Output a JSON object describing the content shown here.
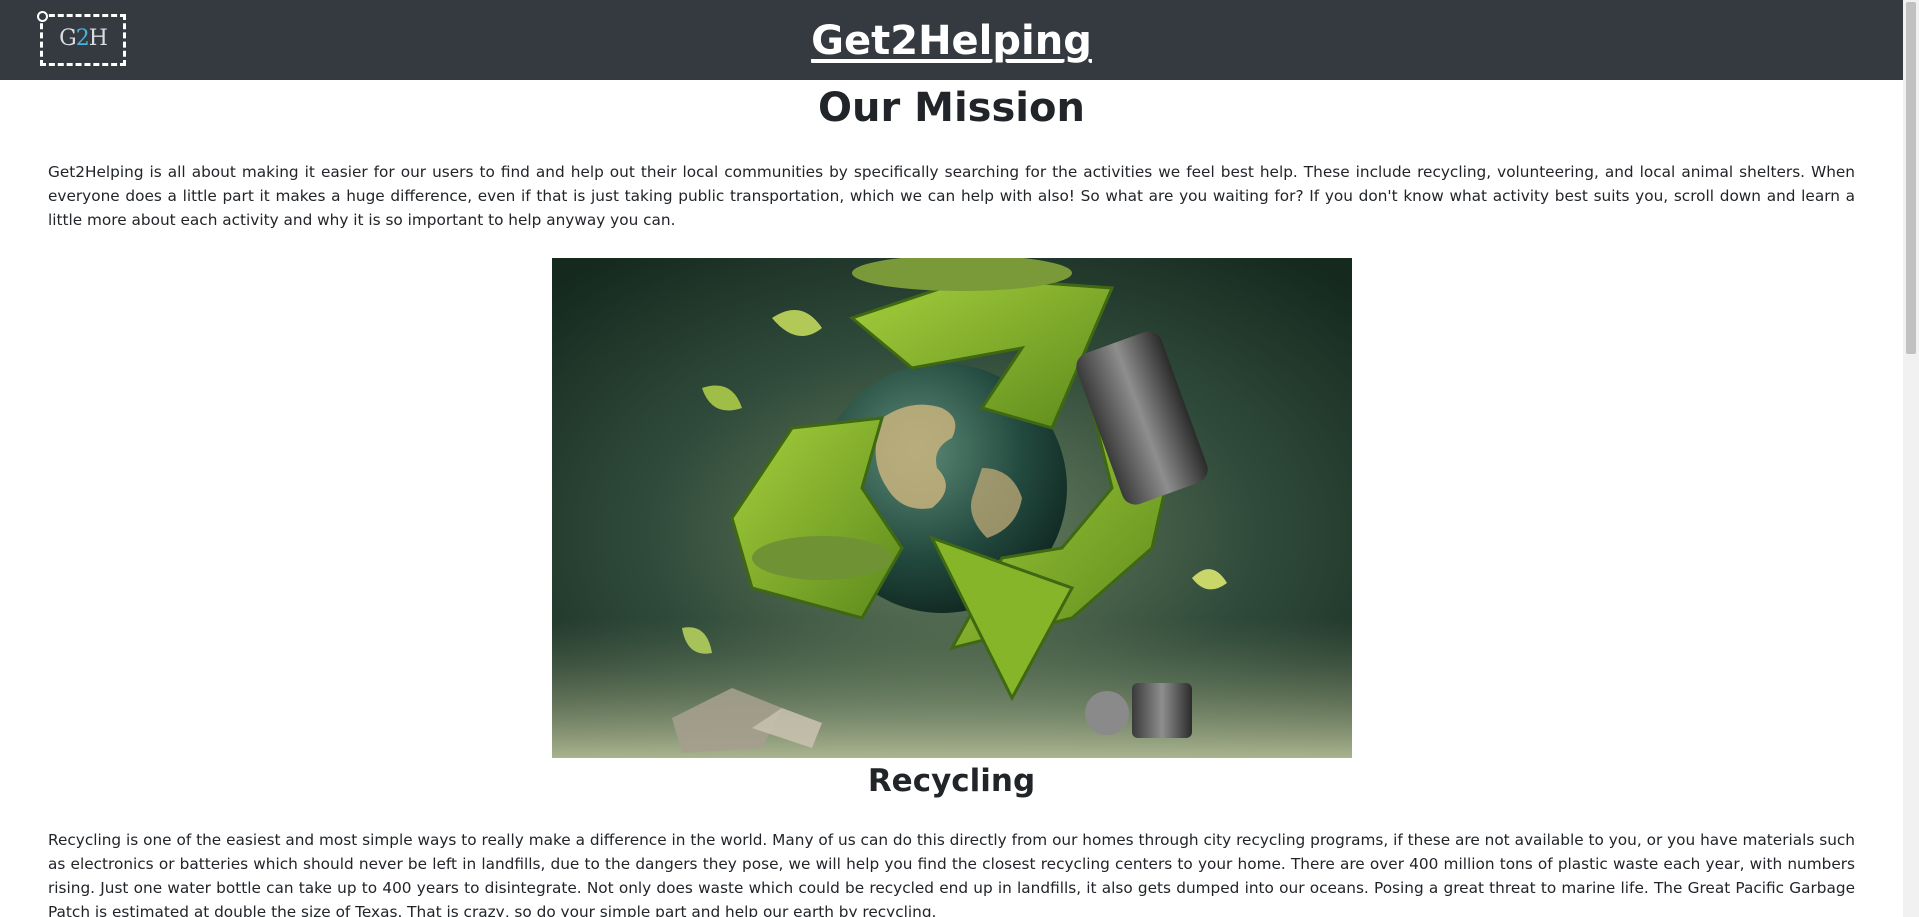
{
  "header": {
    "logo_text_left": "G",
    "logo_text_mid": "2",
    "logo_text_right": "H",
    "site_title": "Get2Helping"
  },
  "mission": {
    "title": "Our Mission",
    "text": "Get2Helping is all about making it easier for our users to find and help out their local communities by specifically searching for the activities we feel best help. These include recycling, volunteering, and local animal shelters. When everyone does a little part it makes a huge difference, even if that is just taking public transportation, which we can help with also! So what are you waiting for? If you don't know what activity best suits you, scroll down and learn a little more about each activity and why it is so important to help anyway you can."
  },
  "recycling": {
    "title": "Recycling",
    "text": "Recycling is one of the easiest and most simple ways to really make a difference in the world. Many of us can do this directly from our homes through city recycling programs, if these are not available to you, or you have materials such as electronics or batteries which should never be left in landfills, due to the dangers they pose, we will help you find the closest recycling centers to your home. There are over 400 million tons of plastic waste each year, with numbers rising. Just one water bottle can take up to 400 years to disintegrate. Not only does waste which could be recycled end up in landfills, it also gets dumped into our oceans. Posing a great threat to marine life. The Great Pacific Garbage Patch is estimated at double the size of Texas. That is crazy, so do your simple part and help our earth by recycling."
  },
  "colors": {
    "navbar": "#343a40",
    "text": "#212529",
    "accent_logo": "#4ab3e3",
    "recycle_green": "#7fb02a"
  },
  "icons": {
    "hero": "recycling-earth-image"
  }
}
